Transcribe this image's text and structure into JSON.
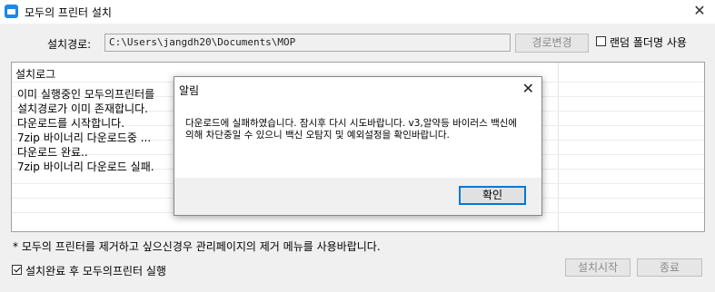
{
  "window": {
    "title": "모두의 프린터 설치"
  },
  "install_path": {
    "label": "설치경로:",
    "value": "C:\\Users\\jangdh20\\Documents\\MOP",
    "change_button": "경로변경",
    "random_folder_label": "랜덤 폴더명 사용",
    "random_folder_checked": false
  },
  "log": {
    "header": "설치로그",
    "lines": [
      "이미 실행중인 모두의프린터를",
      "설치경로가 이미 존재합니다.",
      "다운로드를 시작합니다.",
      "7zip 바이너리 다운로드중 ...",
      "다운로드 완료..",
      "7zip 바이너리 다운로드 실패."
    ]
  },
  "note": "* 모두의 프린터를 제거하고 싶으신경우 관리페이지의  제거 메뉴를 사용바랍니다.",
  "auto_run": {
    "label": "설치완료 후 모두의프린터 실행",
    "checked": true
  },
  "buttons": {
    "start": "설치시작",
    "end": "종료"
  },
  "dialog": {
    "title": "알림",
    "message": "다운로드에 실패하였습니다. 잠시후 다시 시도바랍니다. v3,알약등 바이러스 백신에 의해 차단중일 수 있으니 백신 오탐지 및 예외설정을 확인바랍니다.",
    "ok": "확인"
  }
}
